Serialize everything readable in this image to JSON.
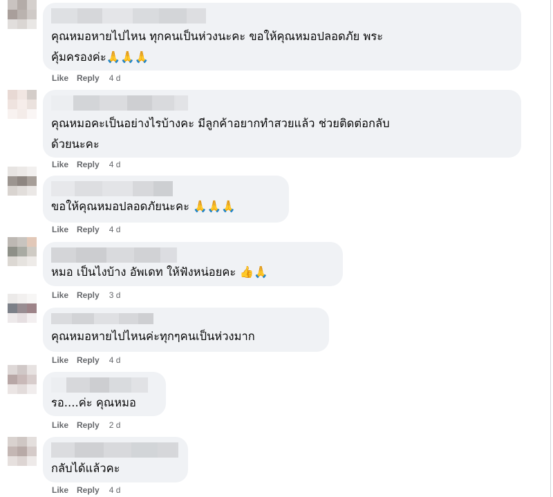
{
  "actions": {
    "like": "Like",
    "reply": "Reply"
  },
  "comments": [
    {
      "text_lines": [
        "คุณหมอหายไปไหน ทุกคนเป็นห่วงนะคะ ขอให้คุณหมอปลอดภัย พระ",
        "คุ้มครองค่ะ🙏🙏🙏"
      ],
      "time": "4 d"
    },
    {
      "text_lines": [
        "คุณหมอคะเป็นอย่างไรบ้างคะ มีลูกค้าอยากทำสวยแล้ว ช่วยติดต่อกลับ",
        "ด้วยนะคะ"
      ],
      "time": "4 d"
    },
    {
      "text_lines": [
        "ขอให้คุณหมอปลอดภัยนะคะ 🙏🙏🙏"
      ],
      "time": "4 d"
    },
    {
      "text_lines": [
        "หมอ เป็นไงบ้าง อัพเดท ให้ฟังหน่อยคะ 👍🙏"
      ],
      "time": "3 d"
    },
    {
      "text_lines": [
        "คุณหมอหายไปไหนค่ะทุกๆคนเป็นห่วงมาก"
      ],
      "time": "4 d"
    },
    {
      "text_lines": [
        "รอ....ค่ะ คุณหมอ"
      ],
      "time": "2 d"
    },
    {
      "text_lines": [
        "กลับได้แล้วคะ"
      ],
      "time": "4 d"
    }
  ],
  "colors": {
    "bubble": "#f0f2f5",
    "text": "#050505",
    "meta": "#65676b"
  }
}
